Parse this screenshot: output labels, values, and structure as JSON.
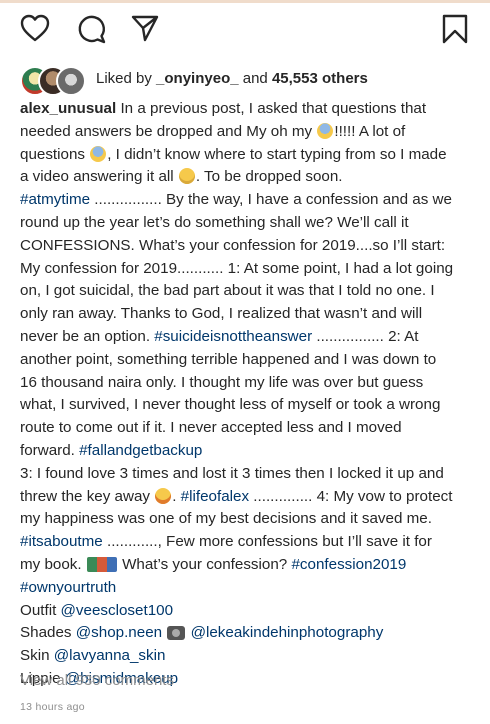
{
  "colors": {
    "text": "#262626",
    "link": "#00376b",
    "muted": "#8e8e8e",
    "background": "#ffffff"
  },
  "actions": {
    "icons": [
      "heart-icon",
      "comment-icon",
      "share-icon",
      "bookmark-icon"
    ]
  },
  "likes": {
    "prefix": "Liked by ",
    "user": "_onyinyeo_",
    "conjunction": " and ",
    "count": "45,553 others"
  },
  "caption": {
    "username": "alex_unusual",
    "lines": [
      [
        {
          "t": "alex_unusual",
          "k": "u"
        },
        {
          "t": " In a previous post, I asked that questions that"
        }
      ],
      [
        {
          "t": "needed answers be dropped and My oh my "
        },
        {
          "e": "emo-fear"
        },
        {
          "t": "!!!!! A lot of"
        }
      ],
      [
        {
          "t": "questions "
        },
        {
          "e": "emo-fear"
        },
        {
          "t": ", I didn’t know where to start typing from so I made"
        }
      ],
      [
        {
          "t": "a video answering it all "
        },
        {
          "e": "emo-smirk"
        },
        {
          "t": ". To be dropped soon."
        }
      ],
      [
        {
          "t": "#atmytime",
          "k": "h"
        },
        {
          "t": " ................ By the way, I have a confession and as we"
        }
      ],
      [
        {
          "t": "round up the year let’s do something shall we? We’ll call it"
        }
      ],
      [
        {
          "t": "CONFESSIONS. What’s your confession for 2019....so I’ll start:"
        }
      ],
      [
        {
          "t": "My confession for 2019........... 1: At some point, I had a lot going"
        }
      ],
      [
        {
          "t": "on, I got suicidal, the bad part about it was that I told no one. I"
        }
      ],
      [
        {
          "t": "only ran away. Thanks to God, I realized that wasn’t and will"
        }
      ],
      [
        {
          "t": "never be an option. "
        },
        {
          "t": "#suicideisnottheanswer",
          "k": "h"
        },
        {
          "t": " ................ 2: At"
        }
      ],
      [
        {
          "t": "another point, something terrible happened and I was down to"
        }
      ],
      [
        {
          "t": "16 thousand naira only. I thought my life was over but guess"
        }
      ],
      [
        {
          "t": "what, I survived, I never thought less of myself or took a wrong"
        }
      ],
      [
        {
          "t": "route to come out if it. I never accepted less and I moved"
        }
      ],
      [
        {
          "t": "forward. "
        },
        {
          "t": "#fallandgetbackup",
          "k": "h"
        }
      ],
      [
        {
          "t": "3: I found love 3 times and lost it 3 times then I locked it up and"
        }
      ],
      [
        {
          "t": "threw the key away "
        },
        {
          "e": "emo-laugh"
        },
        {
          "t": ". "
        },
        {
          "t": "#lifeofalex",
          "k": "h"
        },
        {
          "t": " .............. 4: My vow to protect"
        }
      ],
      [
        {
          "t": "my happiness was one of my best decisions and it saved me."
        }
      ],
      [
        {
          "t": "#itsaboutme",
          "k": "h"
        },
        {
          "t": " ............, Few more confessions but I’ll save it for"
        }
      ],
      [
        {
          "t": "my book. "
        },
        {
          "e": "emo-books"
        },
        {
          "t": " What’s your confession? "
        },
        {
          "t": "#confession2019",
          "k": "h"
        }
      ],
      [
        {
          "t": "#ownyourtruth",
          "k": "h"
        }
      ],
      [
        {
          "t": "Outfit "
        },
        {
          "t": "@veescloset100",
          "k": "h"
        }
      ],
      [
        {
          "t": "Shades "
        },
        {
          "t": "@shop.neen",
          "k": "h"
        },
        {
          "t": " "
        },
        {
          "e": "emo-camera"
        },
        {
          "t": " "
        },
        {
          "t": "@lekeakindehinphotography",
          "k": "h"
        }
      ],
      [
        {
          "t": "Skin "
        },
        {
          "t": "@lavyanna_skin",
          "k": "h"
        }
      ],
      [
        {
          "t": "Lippie "
        },
        {
          "t": "@bismidmakeup",
          "k": "h"
        }
      ]
    ]
  },
  "comments": {
    "view_all": "View all 930 comments"
  },
  "timestamp": "13 hours ago"
}
